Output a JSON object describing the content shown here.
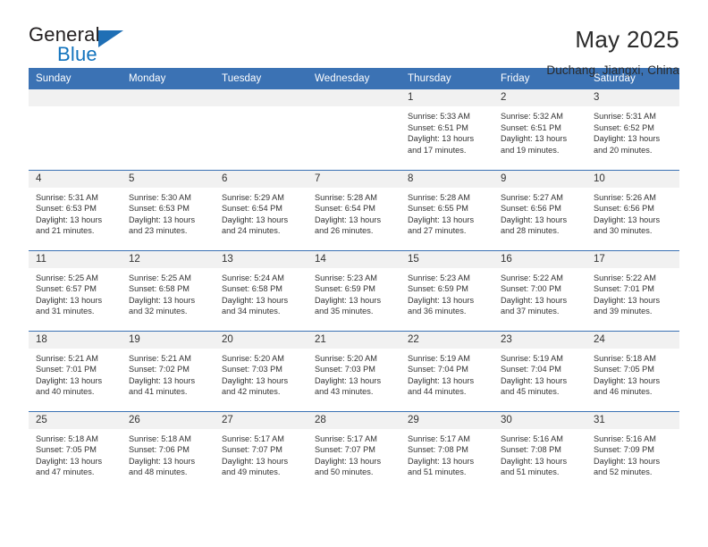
{
  "logo": {
    "word_one": "General",
    "word_two": "Blue",
    "mark": "triangle-mark"
  },
  "header": {
    "title": "May 2025",
    "location": "Duchang, Jiangxi, China"
  },
  "colors": {
    "header_blue": "#3b72b4",
    "logo_blue": "#1273bd",
    "daynum_band": "#f1f1f1",
    "text": "#333333"
  },
  "weekday_headers": [
    "Sunday",
    "Monday",
    "Tuesday",
    "Wednesday",
    "Thursday",
    "Friday",
    "Saturday"
  ],
  "weeks": [
    [
      {
        "day": "",
        "empty": true,
        "sunrise": "",
        "sunset": "",
        "daylight_line1": "",
        "daylight_line2": ""
      },
      {
        "day": "",
        "empty": true,
        "sunrise": "",
        "sunset": "",
        "daylight_line1": "",
        "daylight_line2": ""
      },
      {
        "day": "",
        "empty": true,
        "sunrise": "",
        "sunset": "",
        "daylight_line1": "",
        "daylight_line2": ""
      },
      {
        "day": "",
        "empty": true,
        "sunrise": "",
        "sunset": "",
        "daylight_line1": "",
        "daylight_line2": ""
      },
      {
        "day": "1",
        "empty": false,
        "sunrise": "Sunrise: 5:33 AM",
        "sunset": "Sunset: 6:51 PM",
        "daylight_line1": "Daylight: 13 hours",
        "daylight_line2": "and 17 minutes."
      },
      {
        "day": "2",
        "empty": false,
        "sunrise": "Sunrise: 5:32 AM",
        "sunset": "Sunset: 6:51 PM",
        "daylight_line1": "Daylight: 13 hours",
        "daylight_line2": "and 19 minutes."
      },
      {
        "day": "3",
        "empty": false,
        "sunrise": "Sunrise: 5:31 AM",
        "sunset": "Sunset: 6:52 PM",
        "daylight_line1": "Daylight: 13 hours",
        "daylight_line2": "and 20 minutes."
      }
    ],
    [
      {
        "day": "4",
        "empty": false,
        "sunrise": "Sunrise: 5:31 AM",
        "sunset": "Sunset: 6:53 PM",
        "daylight_line1": "Daylight: 13 hours",
        "daylight_line2": "and 21 minutes."
      },
      {
        "day": "5",
        "empty": false,
        "sunrise": "Sunrise: 5:30 AM",
        "sunset": "Sunset: 6:53 PM",
        "daylight_line1": "Daylight: 13 hours",
        "daylight_line2": "and 23 minutes."
      },
      {
        "day": "6",
        "empty": false,
        "sunrise": "Sunrise: 5:29 AM",
        "sunset": "Sunset: 6:54 PM",
        "daylight_line1": "Daylight: 13 hours",
        "daylight_line2": "and 24 minutes."
      },
      {
        "day": "7",
        "empty": false,
        "sunrise": "Sunrise: 5:28 AM",
        "sunset": "Sunset: 6:54 PM",
        "daylight_line1": "Daylight: 13 hours",
        "daylight_line2": "and 26 minutes."
      },
      {
        "day": "8",
        "empty": false,
        "sunrise": "Sunrise: 5:28 AM",
        "sunset": "Sunset: 6:55 PM",
        "daylight_line1": "Daylight: 13 hours",
        "daylight_line2": "and 27 minutes."
      },
      {
        "day": "9",
        "empty": false,
        "sunrise": "Sunrise: 5:27 AM",
        "sunset": "Sunset: 6:56 PM",
        "daylight_line1": "Daylight: 13 hours",
        "daylight_line2": "and 28 minutes."
      },
      {
        "day": "10",
        "empty": false,
        "sunrise": "Sunrise: 5:26 AM",
        "sunset": "Sunset: 6:56 PM",
        "daylight_line1": "Daylight: 13 hours",
        "daylight_line2": "and 30 minutes."
      }
    ],
    [
      {
        "day": "11",
        "empty": false,
        "sunrise": "Sunrise: 5:25 AM",
        "sunset": "Sunset: 6:57 PM",
        "daylight_line1": "Daylight: 13 hours",
        "daylight_line2": "and 31 minutes."
      },
      {
        "day": "12",
        "empty": false,
        "sunrise": "Sunrise: 5:25 AM",
        "sunset": "Sunset: 6:58 PM",
        "daylight_line1": "Daylight: 13 hours",
        "daylight_line2": "and 32 minutes."
      },
      {
        "day": "13",
        "empty": false,
        "sunrise": "Sunrise: 5:24 AM",
        "sunset": "Sunset: 6:58 PM",
        "daylight_line1": "Daylight: 13 hours",
        "daylight_line2": "and 34 minutes."
      },
      {
        "day": "14",
        "empty": false,
        "sunrise": "Sunrise: 5:23 AM",
        "sunset": "Sunset: 6:59 PM",
        "daylight_line1": "Daylight: 13 hours",
        "daylight_line2": "and 35 minutes."
      },
      {
        "day": "15",
        "empty": false,
        "sunrise": "Sunrise: 5:23 AM",
        "sunset": "Sunset: 6:59 PM",
        "daylight_line1": "Daylight: 13 hours",
        "daylight_line2": "and 36 minutes."
      },
      {
        "day": "16",
        "empty": false,
        "sunrise": "Sunrise: 5:22 AM",
        "sunset": "Sunset: 7:00 PM",
        "daylight_line1": "Daylight: 13 hours",
        "daylight_line2": "and 37 minutes."
      },
      {
        "day": "17",
        "empty": false,
        "sunrise": "Sunrise: 5:22 AM",
        "sunset": "Sunset: 7:01 PM",
        "daylight_line1": "Daylight: 13 hours",
        "daylight_line2": "and 39 minutes."
      }
    ],
    [
      {
        "day": "18",
        "empty": false,
        "sunrise": "Sunrise: 5:21 AM",
        "sunset": "Sunset: 7:01 PM",
        "daylight_line1": "Daylight: 13 hours",
        "daylight_line2": "and 40 minutes."
      },
      {
        "day": "19",
        "empty": false,
        "sunrise": "Sunrise: 5:21 AM",
        "sunset": "Sunset: 7:02 PM",
        "daylight_line1": "Daylight: 13 hours",
        "daylight_line2": "and 41 minutes."
      },
      {
        "day": "20",
        "empty": false,
        "sunrise": "Sunrise: 5:20 AM",
        "sunset": "Sunset: 7:03 PM",
        "daylight_line1": "Daylight: 13 hours",
        "daylight_line2": "and 42 minutes."
      },
      {
        "day": "21",
        "empty": false,
        "sunrise": "Sunrise: 5:20 AM",
        "sunset": "Sunset: 7:03 PM",
        "daylight_line1": "Daylight: 13 hours",
        "daylight_line2": "and 43 minutes."
      },
      {
        "day": "22",
        "empty": false,
        "sunrise": "Sunrise: 5:19 AM",
        "sunset": "Sunset: 7:04 PM",
        "daylight_line1": "Daylight: 13 hours",
        "daylight_line2": "and 44 minutes."
      },
      {
        "day": "23",
        "empty": false,
        "sunrise": "Sunrise: 5:19 AM",
        "sunset": "Sunset: 7:04 PM",
        "daylight_line1": "Daylight: 13 hours",
        "daylight_line2": "and 45 minutes."
      },
      {
        "day": "24",
        "empty": false,
        "sunrise": "Sunrise: 5:18 AM",
        "sunset": "Sunset: 7:05 PM",
        "daylight_line1": "Daylight: 13 hours",
        "daylight_line2": "and 46 minutes."
      }
    ],
    [
      {
        "day": "25",
        "empty": false,
        "sunrise": "Sunrise: 5:18 AM",
        "sunset": "Sunset: 7:05 PM",
        "daylight_line1": "Daylight: 13 hours",
        "daylight_line2": "and 47 minutes."
      },
      {
        "day": "26",
        "empty": false,
        "sunrise": "Sunrise: 5:18 AM",
        "sunset": "Sunset: 7:06 PM",
        "daylight_line1": "Daylight: 13 hours",
        "daylight_line2": "and 48 minutes."
      },
      {
        "day": "27",
        "empty": false,
        "sunrise": "Sunrise: 5:17 AM",
        "sunset": "Sunset: 7:07 PM",
        "daylight_line1": "Daylight: 13 hours",
        "daylight_line2": "and 49 minutes."
      },
      {
        "day": "28",
        "empty": false,
        "sunrise": "Sunrise: 5:17 AM",
        "sunset": "Sunset: 7:07 PM",
        "daylight_line1": "Daylight: 13 hours",
        "daylight_line2": "and 50 minutes."
      },
      {
        "day": "29",
        "empty": false,
        "sunrise": "Sunrise: 5:17 AM",
        "sunset": "Sunset: 7:08 PM",
        "daylight_line1": "Daylight: 13 hours",
        "daylight_line2": "and 51 minutes."
      },
      {
        "day": "30",
        "empty": false,
        "sunrise": "Sunrise: 5:16 AM",
        "sunset": "Sunset: 7:08 PM",
        "daylight_line1": "Daylight: 13 hours",
        "daylight_line2": "and 51 minutes."
      },
      {
        "day": "31",
        "empty": false,
        "sunrise": "Sunrise: 5:16 AM",
        "sunset": "Sunset: 7:09 PM",
        "daylight_line1": "Daylight: 13 hours",
        "daylight_line2": "and 52 minutes."
      }
    ]
  ]
}
